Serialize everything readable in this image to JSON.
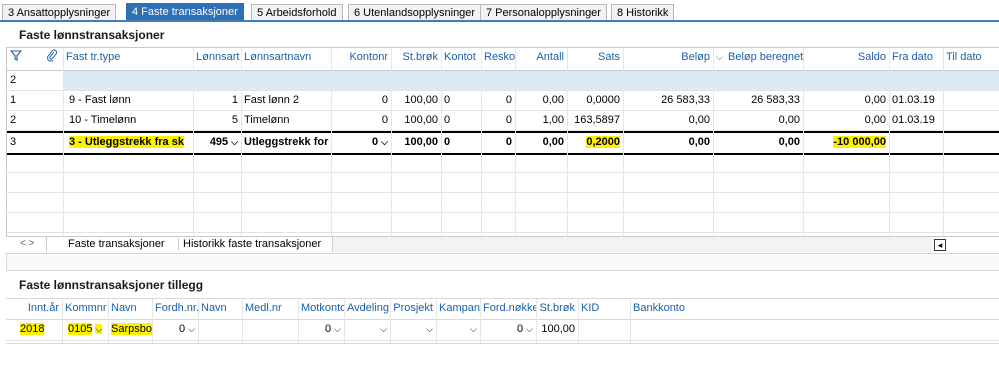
{
  "tabs": [
    {
      "label": "3 Ansattopplysninger",
      "active": false
    },
    {
      "label": "4 Faste transaksjoner",
      "active": true
    },
    {
      "label": "5 Arbeidsforhold",
      "active": false
    },
    {
      "label": "6 Utenlandsopplysninger",
      "active": false
    },
    {
      "label": "7 Personalopplysninger",
      "active": false
    },
    {
      "label": "8 Historikk",
      "active": false
    }
  ],
  "section1": {
    "title": "Faste lønnstransaksjoner"
  },
  "grid1": {
    "columns": [
      "Fast tr.type",
      "Lønnsart",
      "Lønnsartnavn",
      "Kontonr",
      "St.brøk",
      "Kontot",
      "Resko",
      "Antall",
      "Sats",
      "Beløp",
      "Beløp beregnet",
      "Saldo",
      "Fra dato",
      "Til dato"
    ],
    "rows": [
      {
        "num": "2",
        "values": [
          "",
          "",
          "",
          "",
          "",
          "",
          "",
          "",
          "",
          "",
          "",
          "",
          "",
          ""
        ]
      },
      {
        "num": "1",
        "values": [
          "9 - Fast lønn",
          "1",
          "Fast lønn 2",
          "0",
          "100,00",
          "0",
          "0",
          "0,00",
          "0,0000",
          "26 583,33",
          "26 583,33",
          "0,00",
          "01.03.19",
          ""
        ]
      },
      {
        "num": "2",
        "values": [
          "10 - Timelønn",
          "5",
          "Timelønn",
          "0",
          "100,00",
          "0",
          "0",
          "1,00",
          "163,5897",
          "0,00",
          "0,00",
          "0,00",
          "01.03.19",
          ""
        ]
      },
      {
        "num": "3",
        "values": [
          "3 - Utleggstrekk fra sk",
          "495",
          "Utleggstrekk for",
          "0",
          "100,00",
          "0",
          "0",
          "0,00",
          "0,2000",
          "0,00",
          "0,00",
          "-10 000,00",
          "",
          ""
        ]
      }
    ]
  },
  "subtabs": {
    "tab1": "Faste transaksjoner",
    "tab2": "Historikk faste transaksjoner"
  },
  "section2": {
    "title": "Faste lønnstransaksjoner tillegg"
  },
  "grid2": {
    "columns": [
      "Innt.år",
      "Kommnr",
      "Navn",
      "Fordh.nr.",
      "Navn",
      "Medl.nr",
      "Motkonto",
      "Avdeling",
      "Prosjekt",
      "Kampanj",
      "Ford.nøkkel",
      "St.brøk",
      "KID",
      "Bankkonto"
    ],
    "row": [
      "2018",
      "0105",
      "Sarpsbor",
      "0",
      "",
      "",
      "0",
      "",
      "",
      "",
      "0",
      "100,00",
      "",
      ""
    ]
  }
}
